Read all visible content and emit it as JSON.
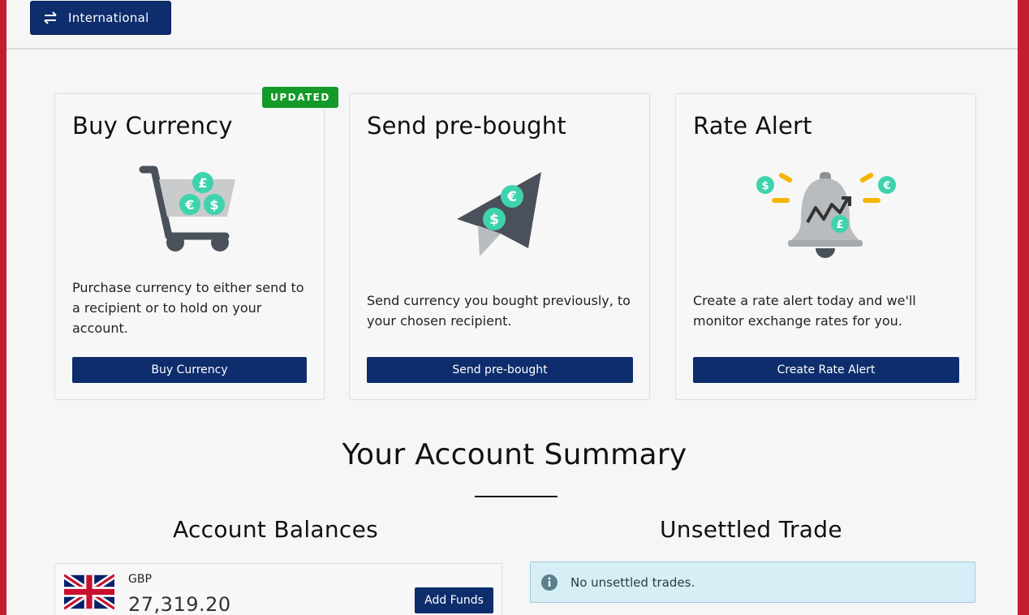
{
  "header": {
    "international_label": "International",
    "international_icon": "swap-arrows-icon"
  },
  "cards": [
    {
      "title": "Buy Currency",
      "badge": "UPDATED",
      "description": "Purchase currency to either send to a recipient or to hold on your account.",
      "button_label": "Buy Currency",
      "icon": "shopping-cart-icon"
    },
    {
      "title": "Send pre-bought",
      "description": "Send currency you bought previously, to your chosen recipient.",
      "button_label": "Send pre-bought",
      "icon": "paper-plane-icon"
    },
    {
      "title": "Rate Alert",
      "description": "Create a rate alert today and we'll monitor exchange rates for you.",
      "button_label": "Create Rate Alert",
      "icon": "bell-icon"
    }
  ],
  "summary": {
    "title": "Your Account Summary",
    "balances_title": "Account Balances",
    "unsettled_title": "Unsettled Trade"
  },
  "balance": {
    "currency": "GBP",
    "amount": "27,319.20",
    "flag_icon": "uk-flag-icon",
    "add_funds_label": "Add Funds"
  },
  "unsettled": {
    "message": "No unsettled trades.",
    "icon": "info-icon"
  },
  "colors": {
    "primary": "#0d2d6c",
    "badge_green": "#149a2a",
    "coin_teal": "#3ed3ad",
    "alert_yellow": "#f2b705",
    "info_bg": "#d7eef6"
  }
}
